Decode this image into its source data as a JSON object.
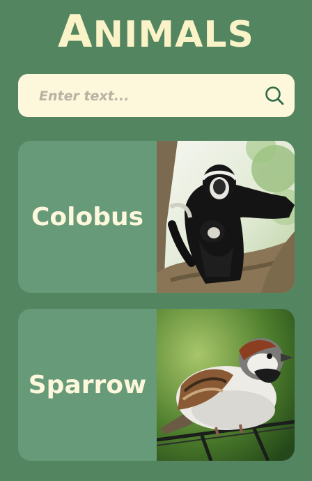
{
  "header": {
    "title_first": "A",
    "title_rest": "NIMALS"
  },
  "search": {
    "placeholder": "Enter text..."
  },
  "cards": [
    {
      "label": "Colobus"
    },
    {
      "label": "Sparrow"
    }
  ]
}
